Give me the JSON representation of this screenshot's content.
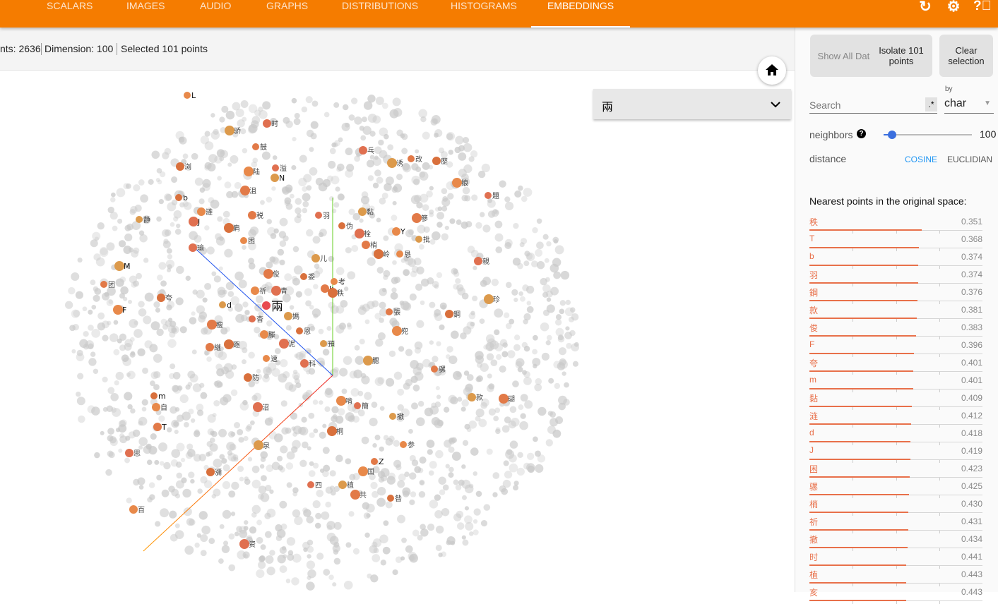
{
  "nav": {
    "tabs": [
      "SCALARS",
      "IMAGES",
      "AUDIO",
      "GRAPHS",
      "DISTRIBUTIONS",
      "HISTOGRAMS",
      "EMBEDDINGS"
    ],
    "active": "EMBEDDINGS",
    "icons": [
      "refresh-icon",
      "settings-icon",
      "help-icon"
    ]
  },
  "info": {
    "points": "nts: 2636",
    "dimension": "Dimension: 100",
    "selected": "Selected 101 points"
  },
  "plot": {
    "selected_label": "兩",
    "dropdown_value": "兩",
    "labels": [
      "L",
      "时",
      "骄",
      "鼓",
      "浏",
      "陆",
      "溢",
      "N",
      "沮",
      "b",
      "涟",
      "J",
      "静",
      "税",
      "肩",
      "困",
      "瑜",
      "M",
      "团",
      "夸",
      "F",
      "羽",
      "儿",
      "俊",
      "委",
      "祈",
      "青",
      "d",
      "k",
      "秩",
      "考",
      "乓",
      "诱",
      "改",
      "歷",
      "娘",
      "題",
      "黏",
      "篸",
      "伪",
      "Y",
      "栓",
      "批",
      "梢",
      "岭",
      "恳",
      "親",
      "珍",
      "張",
      "鋼",
      "兜",
      "杳",
      "媽",
      "瘦",
      "恩",
      "滕",
      "泥",
      "預",
      "継",
      "逐",
      "速",
      "科",
      "腮",
      "骡",
      "防",
      "啃",
      "簡",
      "款",
      "瑚",
      "m",
      "自",
      "沼",
      "撤",
      "T",
      "桐",
      "参",
      "思",
      "泉",
      "Z",
      "瀰",
      "国",
      "四",
      "植",
      "共",
      "昝",
      "百",
      "资"
    ],
    "colors": {
      "selected": "#e84a50",
      "neighbor": "#e8894a",
      "background": "#c8c8c8"
    }
  },
  "panel": {
    "show_all": "Show All Data",
    "isolate": "Isolate 101 points",
    "clear": "Clear selection",
    "search_placeholder": "Search",
    "regex": ".*",
    "by_label": "by",
    "by_value": "char",
    "neighbors_label": "neighbors",
    "neighbors_value": "100",
    "neighbors_fraction": 0.05,
    "distance_label": "distance",
    "cosine": "COSINE",
    "euclidean": "EUCLIDIAN",
    "distance_active": "COSINE",
    "nearest_title": "Nearest points in the original space:",
    "nearest": [
      [
        "秩",
        "0.351"
      ],
      [
        "T",
        "0.368"
      ],
      [
        "b",
        "0.374"
      ],
      [
        "羽",
        "0.374"
      ],
      [
        "鋼",
        "0.376"
      ],
      [
        "款",
        "0.381"
      ],
      [
        "俊",
        "0.383"
      ],
      [
        "F",
        "0.396"
      ],
      [
        "夸",
        "0.401"
      ],
      [
        "m",
        "0.401"
      ],
      [
        "黏",
        "0.409"
      ],
      [
        "涟",
        "0.412"
      ],
      [
        "d",
        "0.418"
      ],
      [
        "J",
        "0.419"
      ],
      [
        "困",
        "0.423"
      ],
      [
        "骡",
        "0.425"
      ],
      [
        "梢",
        "0.430"
      ],
      [
        "祈",
        "0.431"
      ],
      [
        "撤",
        "0.434"
      ],
      [
        "时",
        "0.441"
      ],
      [
        "植",
        "0.443"
      ],
      [
        "亥",
        "0.443"
      ]
    ]
  }
}
